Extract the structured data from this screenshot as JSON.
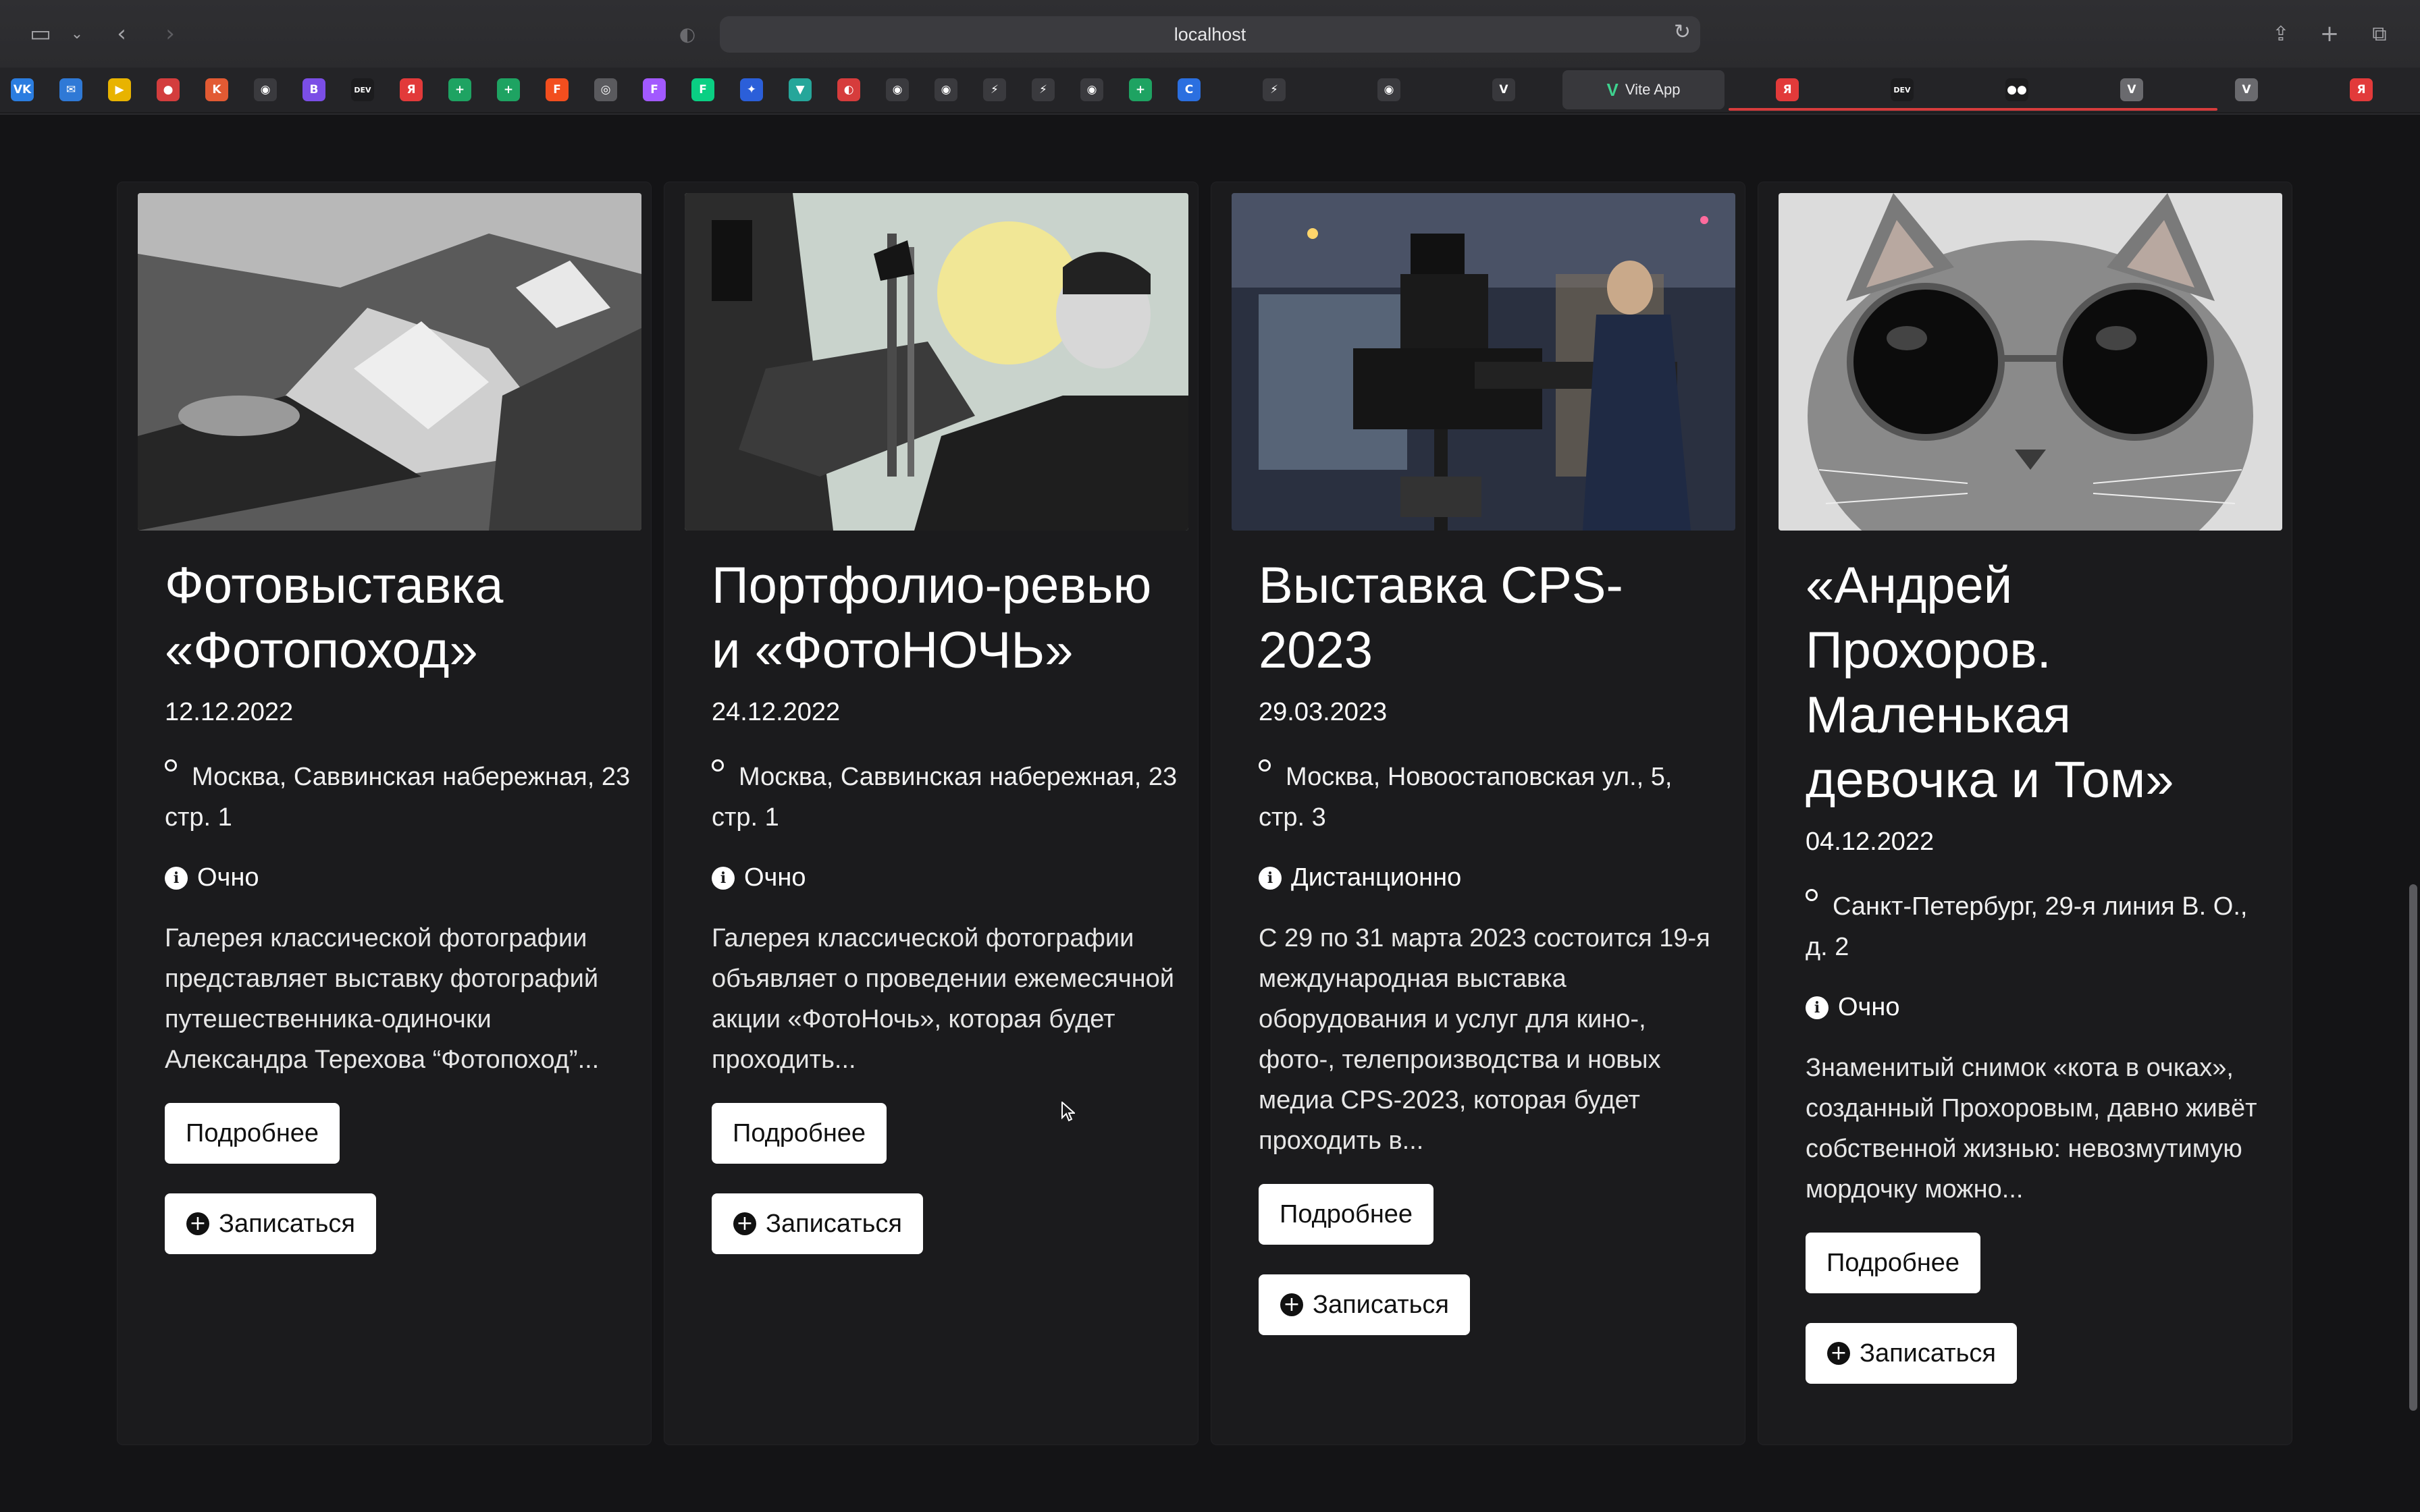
{
  "browser": {
    "url": "localhost",
    "active_tab_title": "Vite App",
    "bookmarks": [
      {
        "icon": "vk-icon",
        "color": "#2b7de0",
        "glyph": "VK"
      },
      {
        "icon": "mail-icon",
        "color": "#2f79d6",
        "glyph": "✉"
      },
      {
        "icon": "youtube-music-icon",
        "color": "#e8b300",
        "glyph": "▶"
      },
      {
        "icon": "circle-icon",
        "color": "#d33d3d",
        "glyph": "●"
      },
      {
        "icon": "flag-icon",
        "color": "#e25a33",
        "glyph": "K"
      },
      {
        "icon": "github-icon",
        "color": "#3a3a3e",
        "glyph": "◉"
      },
      {
        "icon": "bootstrap-icon",
        "color": "#7b4ee6",
        "glyph": "B"
      },
      {
        "icon": "dev-icon",
        "color": "#1c1c1e",
        "glyph": "DEV"
      },
      {
        "icon": "yandex-icon",
        "color": "#e23a3a",
        "glyph": "Я"
      },
      {
        "icon": "sheets-icon",
        "color": "#1ea362",
        "glyph": "+"
      },
      {
        "icon": "sheets-icon",
        "color": "#1ea362",
        "glyph": "+"
      },
      {
        "icon": "figma-icon",
        "color": "#f24e1e",
        "glyph": "F"
      },
      {
        "icon": "app-icon",
        "color": "#5a5a5e",
        "glyph": "◎"
      },
      {
        "icon": "figma-icon",
        "color": "#a259ff",
        "glyph": "F"
      },
      {
        "icon": "figma-icon",
        "color": "#0acf83",
        "glyph": "F"
      },
      {
        "icon": "puzzle-icon",
        "color": "#2b5fd9",
        "glyph": "✦"
      },
      {
        "icon": "shield-icon",
        "color": "#26a69a",
        "glyph": "▼"
      },
      {
        "icon": "fire-icon",
        "color": "#d63c3c",
        "glyph": "◐"
      },
      {
        "icon": "github-icon",
        "color": "#3a3a3e",
        "glyph": "◉"
      },
      {
        "icon": "github-icon",
        "color": "#3a3a3e",
        "glyph": "◉"
      },
      {
        "icon": "lightning-icon",
        "color": "#3a3a3e",
        "glyph": "⚡"
      },
      {
        "icon": "lightning-icon",
        "color": "#3a3a3e",
        "glyph": "⚡"
      },
      {
        "icon": "github-icon",
        "color": "#3a3a3e",
        "glyph": "◉"
      },
      {
        "icon": "sheets-icon",
        "color": "#1ea362",
        "glyph": "+"
      },
      {
        "icon": "chrome-icon",
        "color": "#2b6fe0",
        "glyph": "C"
      }
    ],
    "tabs": [
      {
        "icon": "lightning-icon",
        "glyph": "⚡",
        "color": "#3a3a3e"
      },
      {
        "icon": "github-icon",
        "glyph": "◉",
        "color": "#3a3a3e"
      },
      {
        "icon": "vue-icon",
        "glyph": "V",
        "color": "#38383c"
      },
      {
        "icon": "yandex-icon",
        "glyph": "Я",
        "color": "#e23a3a"
      },
      {
        "icon": "dev-icon",
        "glyph": "DEV",
        "color": "#1c1c1e"
      },
      {
        "icon": "medium-icon",
        "glyph": "●●",
        "color": "#1c1c1e"
      },
      {
        "icon": "v-icon",
        "glyph": "V",
        "color": "#6a6a6e"
      },
      {
        "icon": "v-icon",
        "glyph": "V",
        "color": "#6a6a6e"
      },
      {
        "icon": "yandex-icon",
        "glyph": "Я",
        "color": "#e23a3a"
      }
    ]
  },
  "events": [
    {
      "title": "Фотовыставка «Фотопоход»",
      "date": "12.12.2022",
      "address": "Москва, Саввинская набережная, 23 стр. 1",
      "mode": "Очно",
      "description": "Галерея классической фотографии представляет выставку фотографий путешественника-одиночки Александра Терехова “Фотопоход”...",
      "more_label": "Подробнее",
      "signup_label": "Записаться"
    },
    {
      "title": "Портфолио-ревью и «ФотоНОЧЬ»",
      "date": "24.12.2022",
      "address": "Москва, Саввинская набережная, 23 стр. 1",
      "mode": "Очно",
      "description": "Галерея классической фотографии объявляет о проведении ежемесячной акции «ФотоНочь», которая будет проходить...",
      "more_label": "Подробнее",
      "signup_label": "Записаться"
    },
    {
      "title": "Выставка CPS-2023",
      "date": "29.03.2023",
      "address": "Москва, Новоостаповская ул., 5, стр. 3",
      "mode": "Дистанционно",
      "description": "С 29 по 31 марта 2023 состоится 19-я международная выставка оборудования и услуг для кино-, фото-, телепроизводства и новых медиа CPS-2023, которая будет проходить в...",
      "more_label": "Подробнее",
      "signup_label": "Записаться"
    },
    {
      "title": "«Андрей Прохоров. Маленькая девочка и Том»",
      "date": "04.12.2022",
      "address": "Санкт-Петербург, 29-я линия В. О., д. 2",
      "mode": "Очно",
      "description": "Знаменитый снимок «кота в очках», созданный Прохоровым, давно живёт собственной жизнью: невозмутимую мордочку можно...",
      "more_label": "Подробнее",
      "signup_label": "Записаться"
    }
  ]
}
